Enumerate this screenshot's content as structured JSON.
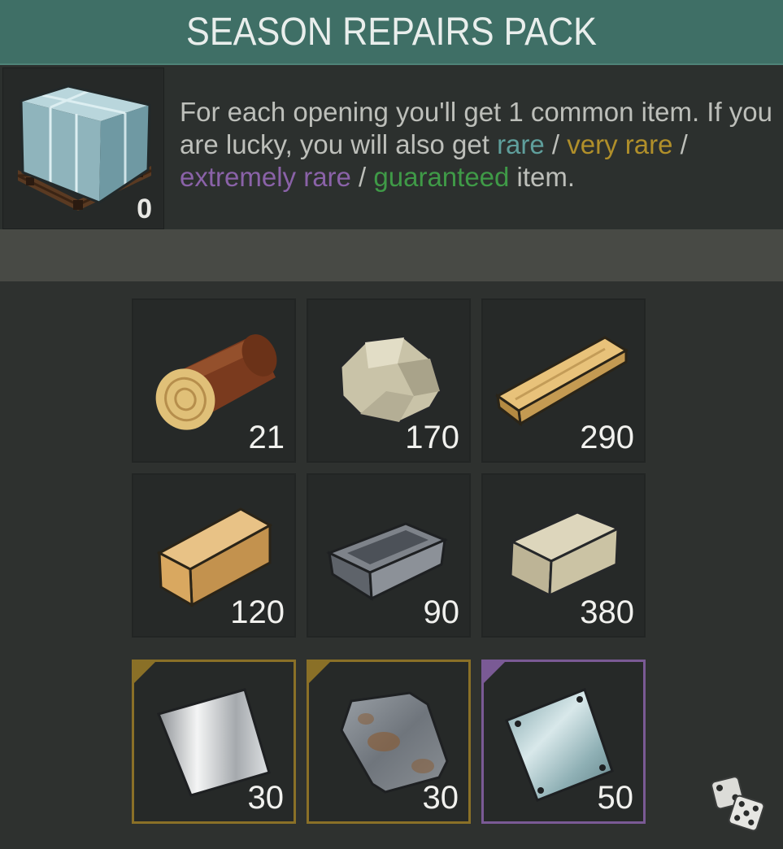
{
  "header": {
    "title": "SEASON REPAIRS PACK"
  },
  "pack": {
    "icon": "crate-icon",
    "count": "0"
  },
  "description": {
    "part1": "For each opening you'll get 1 common item. If you are lucky, you will also get ",
    "rare": "rare",
    "sep1": " / ",
    "very_rare": "very rare",
    "sep2": " / ",
    "extremely_rare": "extremely rare",
    "sep3": " / ",
    "guaranteed": "guaranteed",
    "part2": " item.",
    "colors": {
      "rare": "#5f9f9c",
      "very_rare": "#b08f2a",
      "extremely_rare": "#8a62a8",
      "guaranteed": "#3f9a47"
    }
  },
  "items": [
    {
      "icon": "log-icon",
      "qty": "21",
      "rarity": "common"
    },
    {
      "icon": "stone-icon",
      "qty": "170",
      "rarity": "common"
    },
    {
      "icon": "plank-icon",
      "qty": "290",
      "rarity": "common"
    },
    {
      "icon": "timber-beam-icon",
      "qty": "120",
      "rarity": "common"
    },
    {
      "icon": "iron-ingot-icon",
      "qty": "90",
      "rarity": "common"
    },
    {
      "icon": "limestone-block-icon",
      "qty": "380",
      "rarity": "common"
    },
    {
      "icon": "metal-sheet-icon",
      "qty": "30",
      "rarity": "very rare"
    },
    {
      "icon": "rusty-metal-plate-icon",
      "qty": "30",
      "rarity": "very rare"
    },
    {
      "icon": "steel-plate-icon",
      "qty": "50",
      "rarity": "extremely rare"
    }
  ],
  "footer": {
    "dice_icon": "dice-icon"
  }
}
